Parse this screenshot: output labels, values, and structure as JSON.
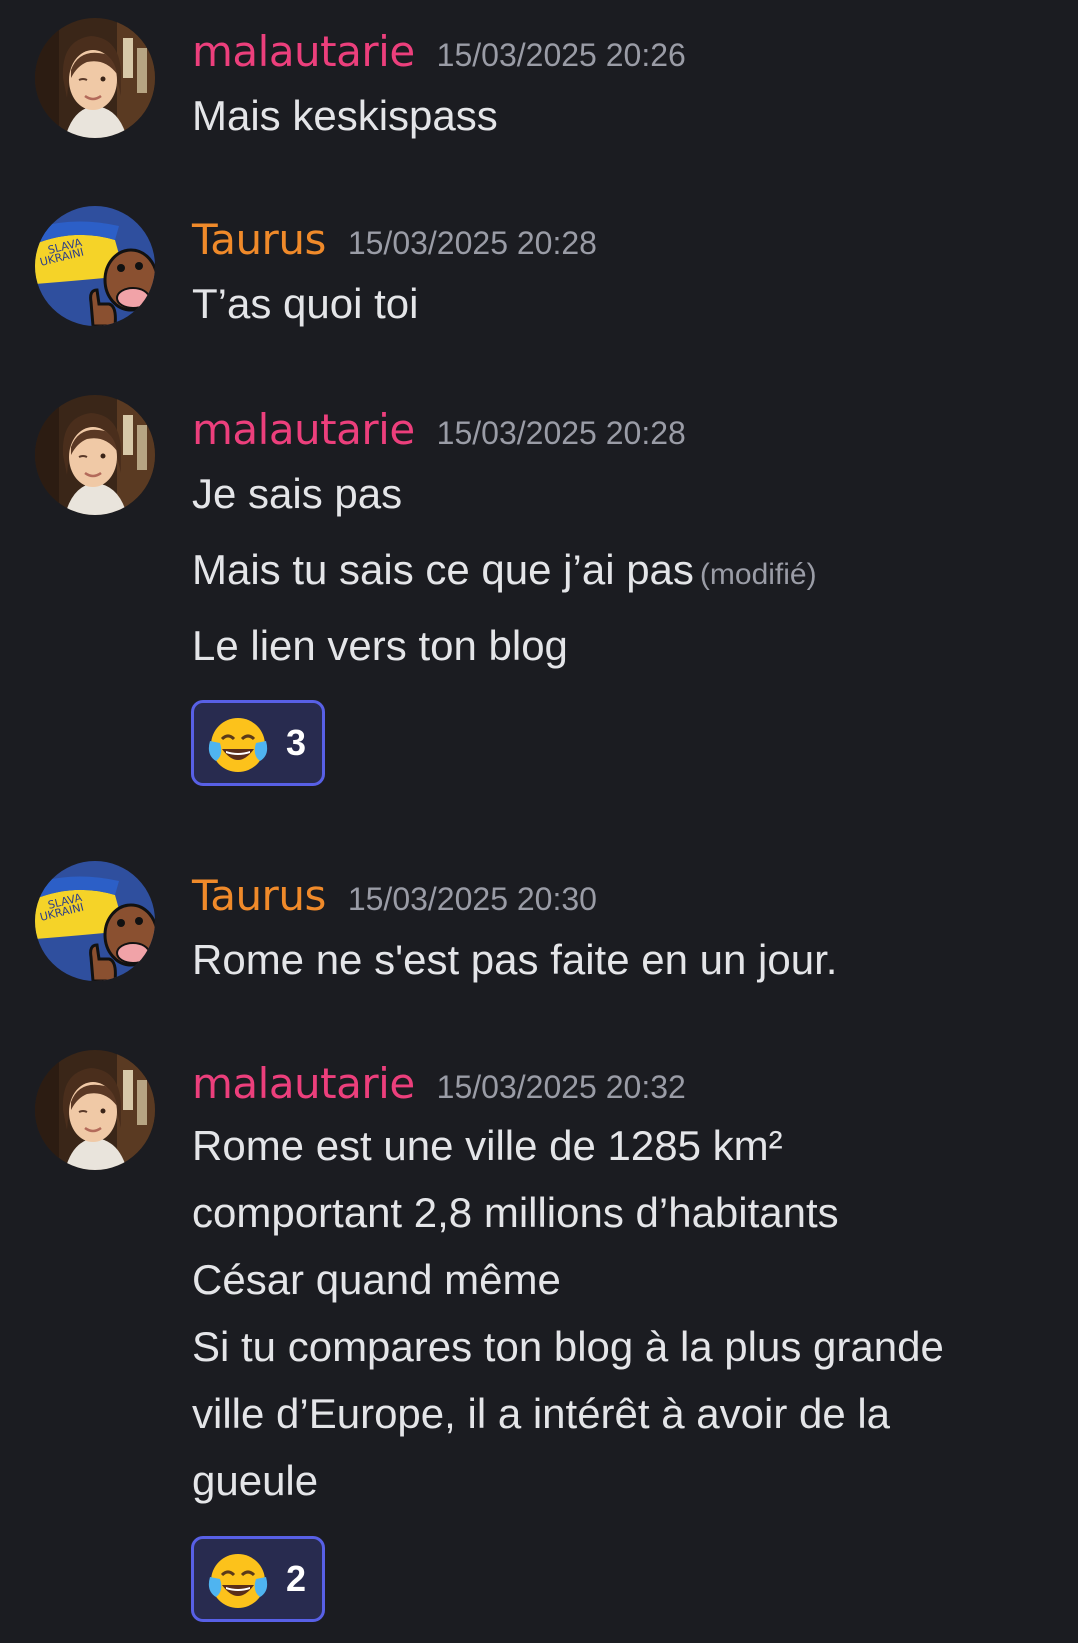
{
  "colors": {
    "background": "#1b1c21",
    "username_malautarie": "#ec3f7c",
    "username_taurus": "#f08a2a",
    "text": "#e4e5e8",
    "muted": "#9a9ca6",
    "reaction_border": "#5860e6",
    "reaction_bg": "#282b4f"
  },
  "messages": [
    {
      "author": "malautarie",
      "timestamp": "15/03/2025 20:26",
      "lines": [
        "Mais keskispass"
      ]
    },
    {
      "author": "Taurus",
      "timestamp": "15/03/2025 20:28",
      "lines": [
        "T’as quoi toi"
      ]
    },
    {
      "author": "malautarie",
      "timestamp": "15/03/2025 20:28",
      "lines": [
        "Je sais pas",
        "Mais tu sais ce que j’ai pas",
        "Le lien vers ton blog"
      ],
      "edited_label": "(modifié)",
      "reaction": {
        "emoji": "joy-emoji",
        "count": "3"
      }
    },
    {
      "author": "Taurus",
      "timestamp": "15/03/2025 20:30",
      "lines": [
        "Rome ne s'est pas faite en un jour."
      ]
    },
    {
      "author": "malautarie",
      "timestamp": "15/03/2025 20:32",
      "lines": [
        "Rome est une ville de 1285 km²",
        "comportant 2,8 millions d’habitants",
        "César quand même",
        "Si tu compares ton blog à la plus grande",
        "ville d’Europe, il a intérêt à avoir de la",
        "gueule"
      ],
      "reaction": {
        "emoji": "joy-emoji",
        "count": "2"
      }
    }
  ]
}
